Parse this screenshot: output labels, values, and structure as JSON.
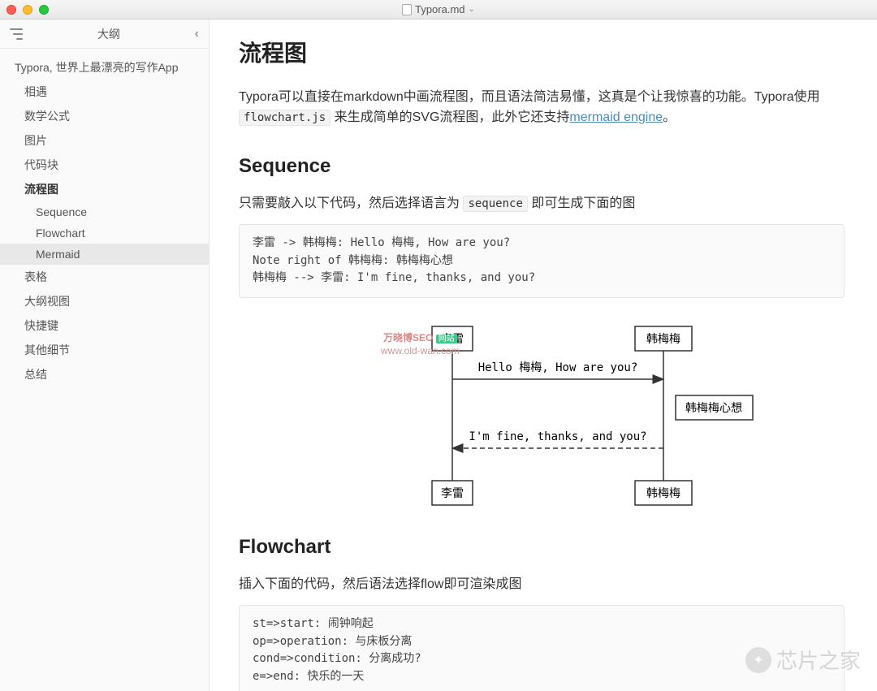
{
  "window": {
    "title": "Typora.md"
  },
  "sidebar": {
    "title": "大纲",
    "items": [
      {
        "label": "Typora, 世界上最漂亮的写作App",
        "level": 1
      },
      {
        "label": "相遇",
        "level": 2
      },
      {
        "label": "数学公式",
        "level": 2
      },
      {
        "label": "图片",
        "level": 2
      },
      {
        "label": "代码块",
        "level": 2
      },
      {
        "label": "流程图",
        "level": 2,
        "bold": true
      },
      {
        "label": "Sequence",
        "level": 3
      },
      {
        "label": "Flowchart",
        "level": 3
      },
      {
        "label": "Mermaid",
        "level": 3,
        "selected": true
      },
      {
        "label": "表格",
        "level": 2
      },
      {
        "label": "大纲视图",
        "level": 2
      },
      {
        "label": "快捷键",
        "level": 2
      },
      {
        "label": "其他细节",
        "level": 2
      },
      {
        "label": "总结",
        "level": 2
      }
    ]
  },
  "content": {
    "h1": "流程图",
    "intro_1": "Typora可以直接在markdown中画流程图，而且语法简洁易懂，这真是个让我惊喜的功能。Typora使用 ",
    "intro_code": "flowchart.js",
    "intro_2": " 来生成简单的SVG流程图，此外它还支持",
    "intro_link": "mermaid engine",
    "intro_3": "。",
    "seq_h2": "Sequence",
    "seq_p1": "只需要敲入以下代码，然后选择语言为 ",
    "seq_code": "sequence",
    "seq_p2": " 即可生成下面的图",
    "seq_block": "李雷 -> 韩梅梅: Hello 梅梅, How are you?\nNote right of 韩梅梅: 韩梅梅心想\n韩梅梅 --> 李雷: I'm fine, thanks, and you?",
    "diagram": {
      "actor_left_top": "李雷",
      "actor_right_top": "韩梅梅",
      "actor_left_bottom": "李雷",
      "actor_right_bottom": "韩梅梅",
      "msg1": "Hello 梅梅, How are you?",
      "note": "韩梅梅心想",
      "msg2": "I'm fine, thanks, and you?"
    },
    "flow_h2": "Flowchart",
    "flow_p": "插入下面的代码，然后语法选择flow即可渲染成图",
    "flow_block": "st=>start: 闹钟响起\nop=>operation: 与床板分离\ncond=>condition: 分离成功?\ne=>end: 快乐的一天"
  },
  "watermark": {
    "brand": "万晓博SEO",
    "badge": "网站",
    "url": "www.old-wan.com"
  },
  "bottom_watermark": "芯片之家"
}
